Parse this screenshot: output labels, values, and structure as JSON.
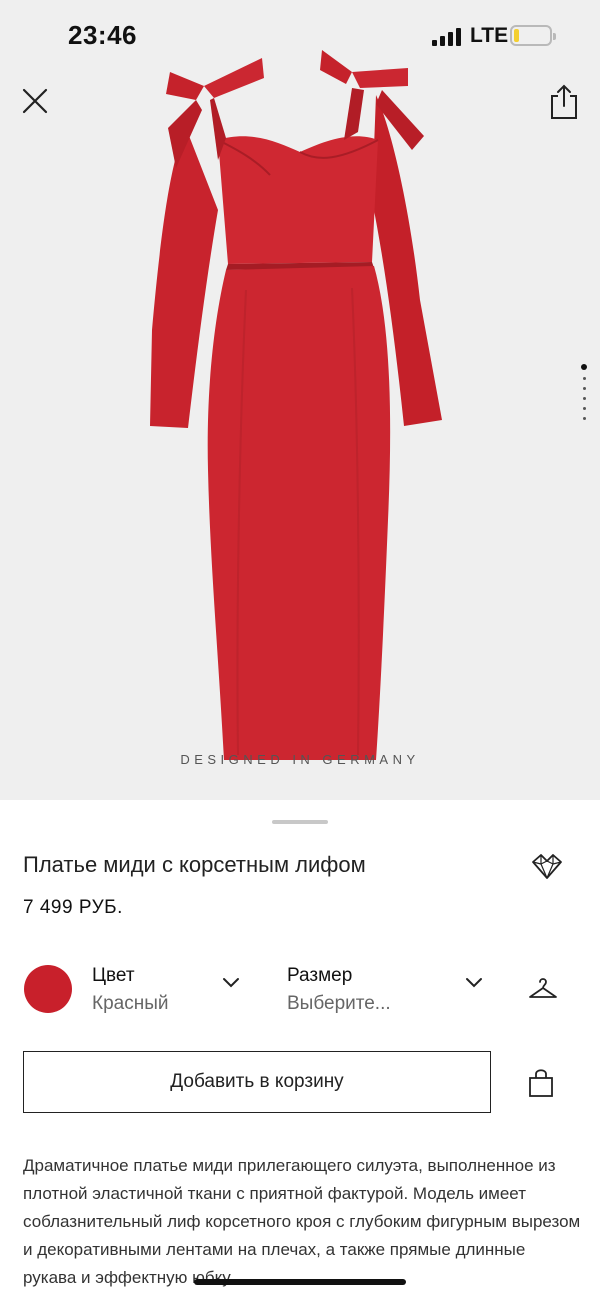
{
  "status_bar": {
    "time": "23:46",
    "network": "LTE",
    "battery_level": 0.15
  },
  "hero": {
    "caption": "DESIGNED IN GERMANY",
    "image_count": 6,
    "active_image_index": 0,
    "dress_color": "#cc2630"
  },
  "product": {
    "title": "Платье миди с корсетным лифом",
    "price": "7 499 РУБ."
  },
  "options": {
    "color_label": "Цвет",
    "color_value": "Красный",
    "swatch_color": "#c8202b",
    "size_label": "Размер",
    "size_placeholder": "Выберите..."
  },
  "actions": {
    "add_to_cart": "Добавить в корзину"
  },
  "description": "Драматичное платье миди прилегающего силуэта, выполненное из плотной эластичной ткани с приятной фактурой. Модель имеет соблазнительный лиф корсетного кроя с глубоким фигурным вырезом и декоративными лентами на плечах, а также прямые длинные рукава и эффектную юбку",
  "icons": {
    "close": "close-icon",
    "share": "share-icon",
    "favorite": "favorite-icon",
    "hanger": "hanger-icon",
    "bag": "shopping-bag-icon"
  }
}
